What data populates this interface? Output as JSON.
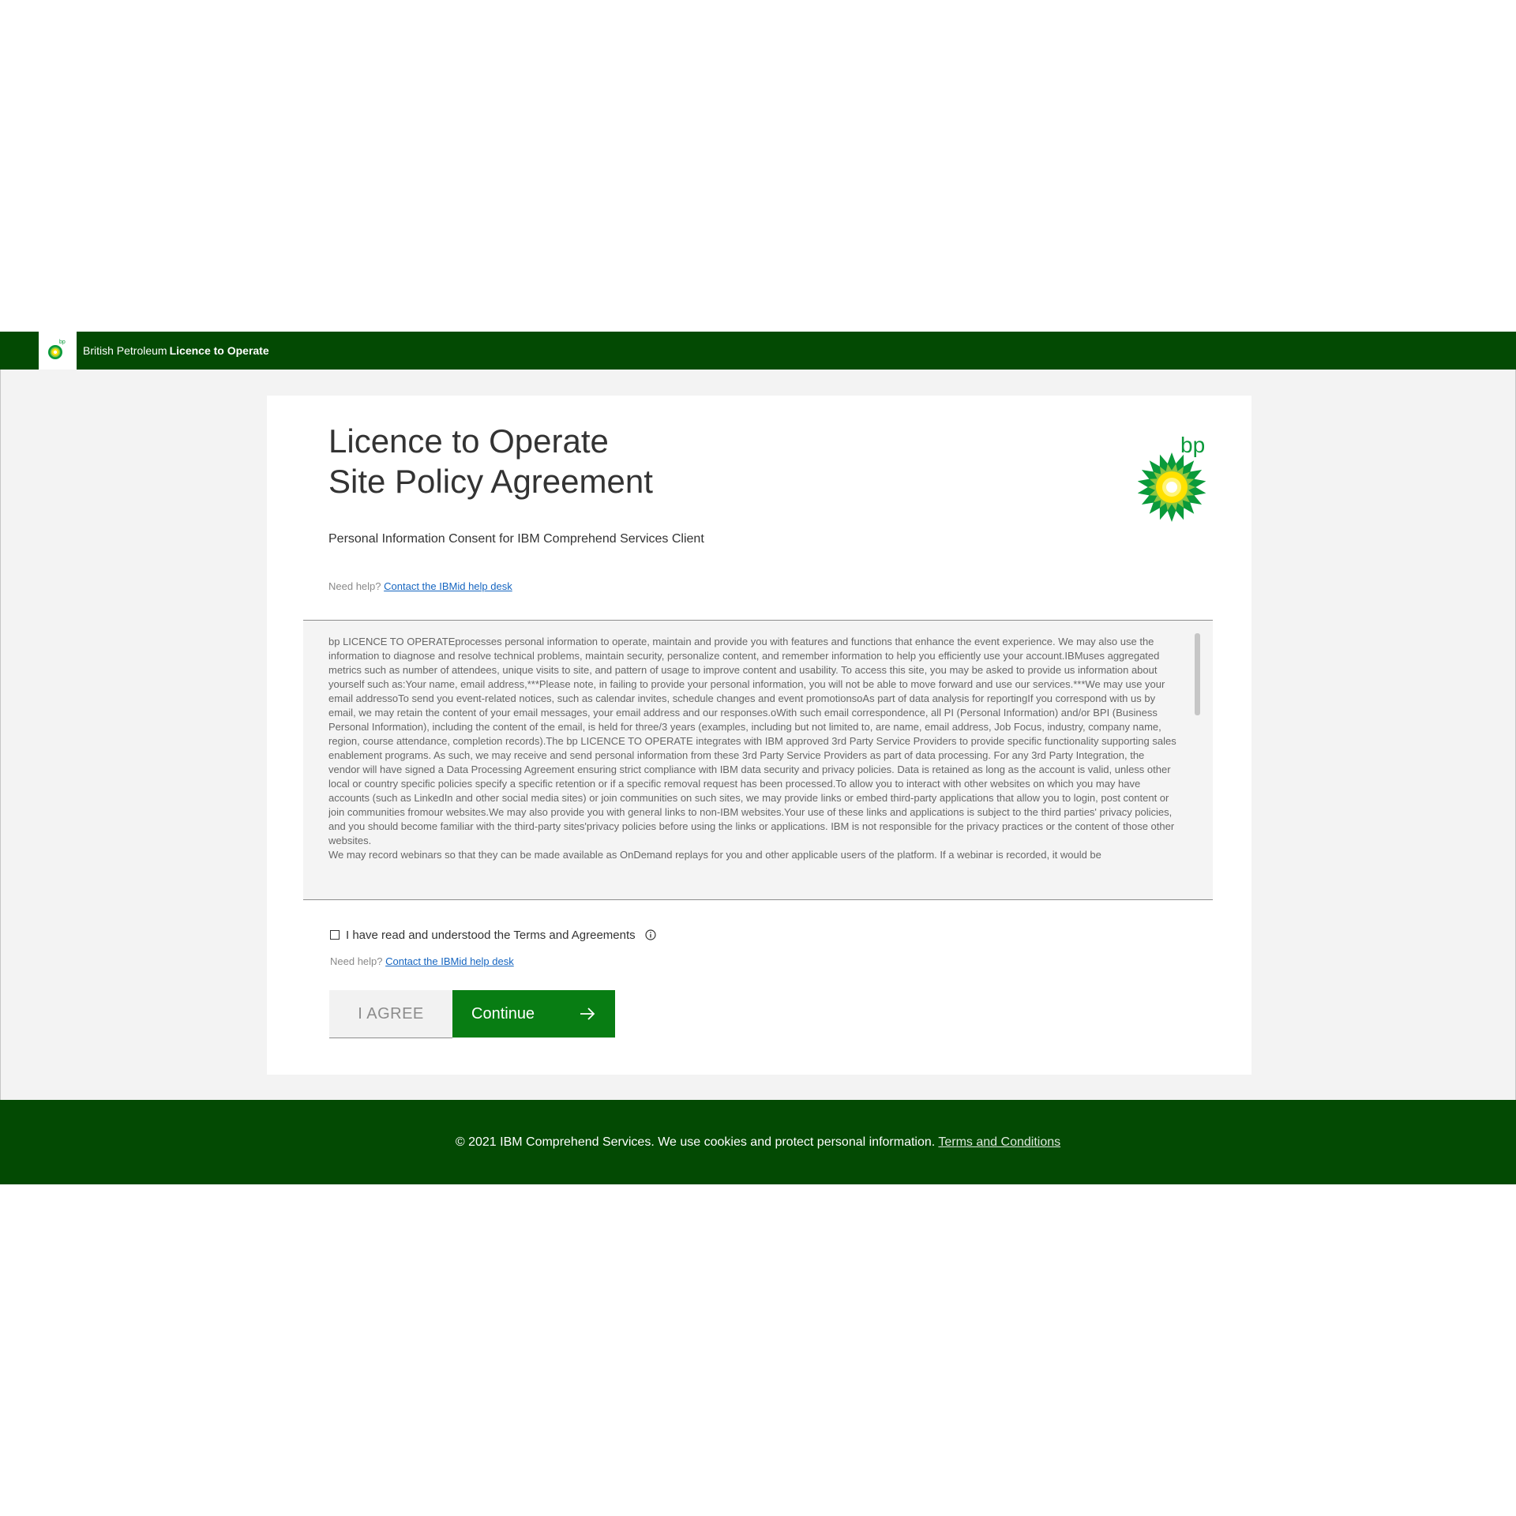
{
  "header": {
    "brand": "British Petroleum",
    "app_name": "Licence to Operate"
  },
  "card": {
    "title_line1": "Licence to Operate",
    "title_line2": "Site Policy Agreement",
    "subtitle": "Personal Information Consent for IBM Comprehend Services Client",
    "logo_text": "bp",
    "help_prefix": "Need help?",
    "help_link": "Contact the IBMid help desk"
  },
  "terms": {
    "paragraph1": "bp LICENCE TO OPERATEprocesses personal information to operate, maintain and provide you with features and functions that enhance the event experience. We may also use the information to diagnose and resolve technical problems, maintain security, personalize content, and remember information to help you efficiently use your account.IBMuses aggregated metrics such as number of attendees, unique visits to site, and pattern of usage to improve content and usability. To access this site, you may be asked to provide us information about yourself such as:Your name, email address,***Please note, in failing to provide your personal information, you will not be able to move forward and use our services.***We may use your email addressoTo send you event-related notices, such as calendar invites, schedule changes and event promotionsoAs part of data analysis for reportingIf you correspond with us by email, we may retain the content of your email messages, your email address and our responses.oWith such email correspondence, all PI (Personal Information) and/or BPI (Business Personal Information), including the content of the email, is held for three/3 years (examples, including but not limited to, are name, email address, Job Focus, industry, company name, region, course attendance, completion records).The bp LICENCE TO OPERATE integrates with IBM approved 3rd Party Service Providers to provide specific functionality supporting sales enablement programs. As such, we may receive and send personal information from these 3rd Party Service Providers as part of data processing. For any 3rd Party Integration, the vendor will have signed a Data Processing Agreement ensuring strict compliance with IBM data security and privacy policies. Data is retained as long as the account is valid, unless other local or country specific policies specify a specific retention or if a specific removal request has been processed.To allow you to interact with other websites on which you may have accounts (such as LinkedIn and other social media sites) or join communities on such sites, we may provide links or embed third-party applications that allow you to login, post content or join communities fromour websites.We may also provide you with general links to non-IBM websites.Your use of these links and applications is subject to the third parties' privacy policies, and you should become familiar with the third-party sites'privacy policies before using the links or applications. IBM is not responsible for the privacy practices or the content of those other websites.",
    "paragraph2": "We may record webinars so that they can be made available as OnDemand replays for you and other applicable users of the platform. If a webinar is recorded, it would be"
  },
  "agreement": {
    "checkbox_label": "I have read and understood the Terms and Agreements",
    "help_prefix": "Need help?",
    "help_link": "Contact the IBMid help desk"
  },
  "buttons": {
    "agree": "I AGREE",
    "continue": "Continue"
  },
  "footer": {
    "text": "© 2021 IBM Comprehend Services. We use cookies and protect personal information.",
    "link": "Terms and Conditions"
  },
  "colors": {
    "brand_green": "#034a03",
    "button_green": "#087d13",
    "link_blue": "#1565c0"
  },
  "icons": [
    "bp-helios-icon",
    "info-icon",
    "arrow-right-icon",
    "checkbox-icon"
  ]
}
